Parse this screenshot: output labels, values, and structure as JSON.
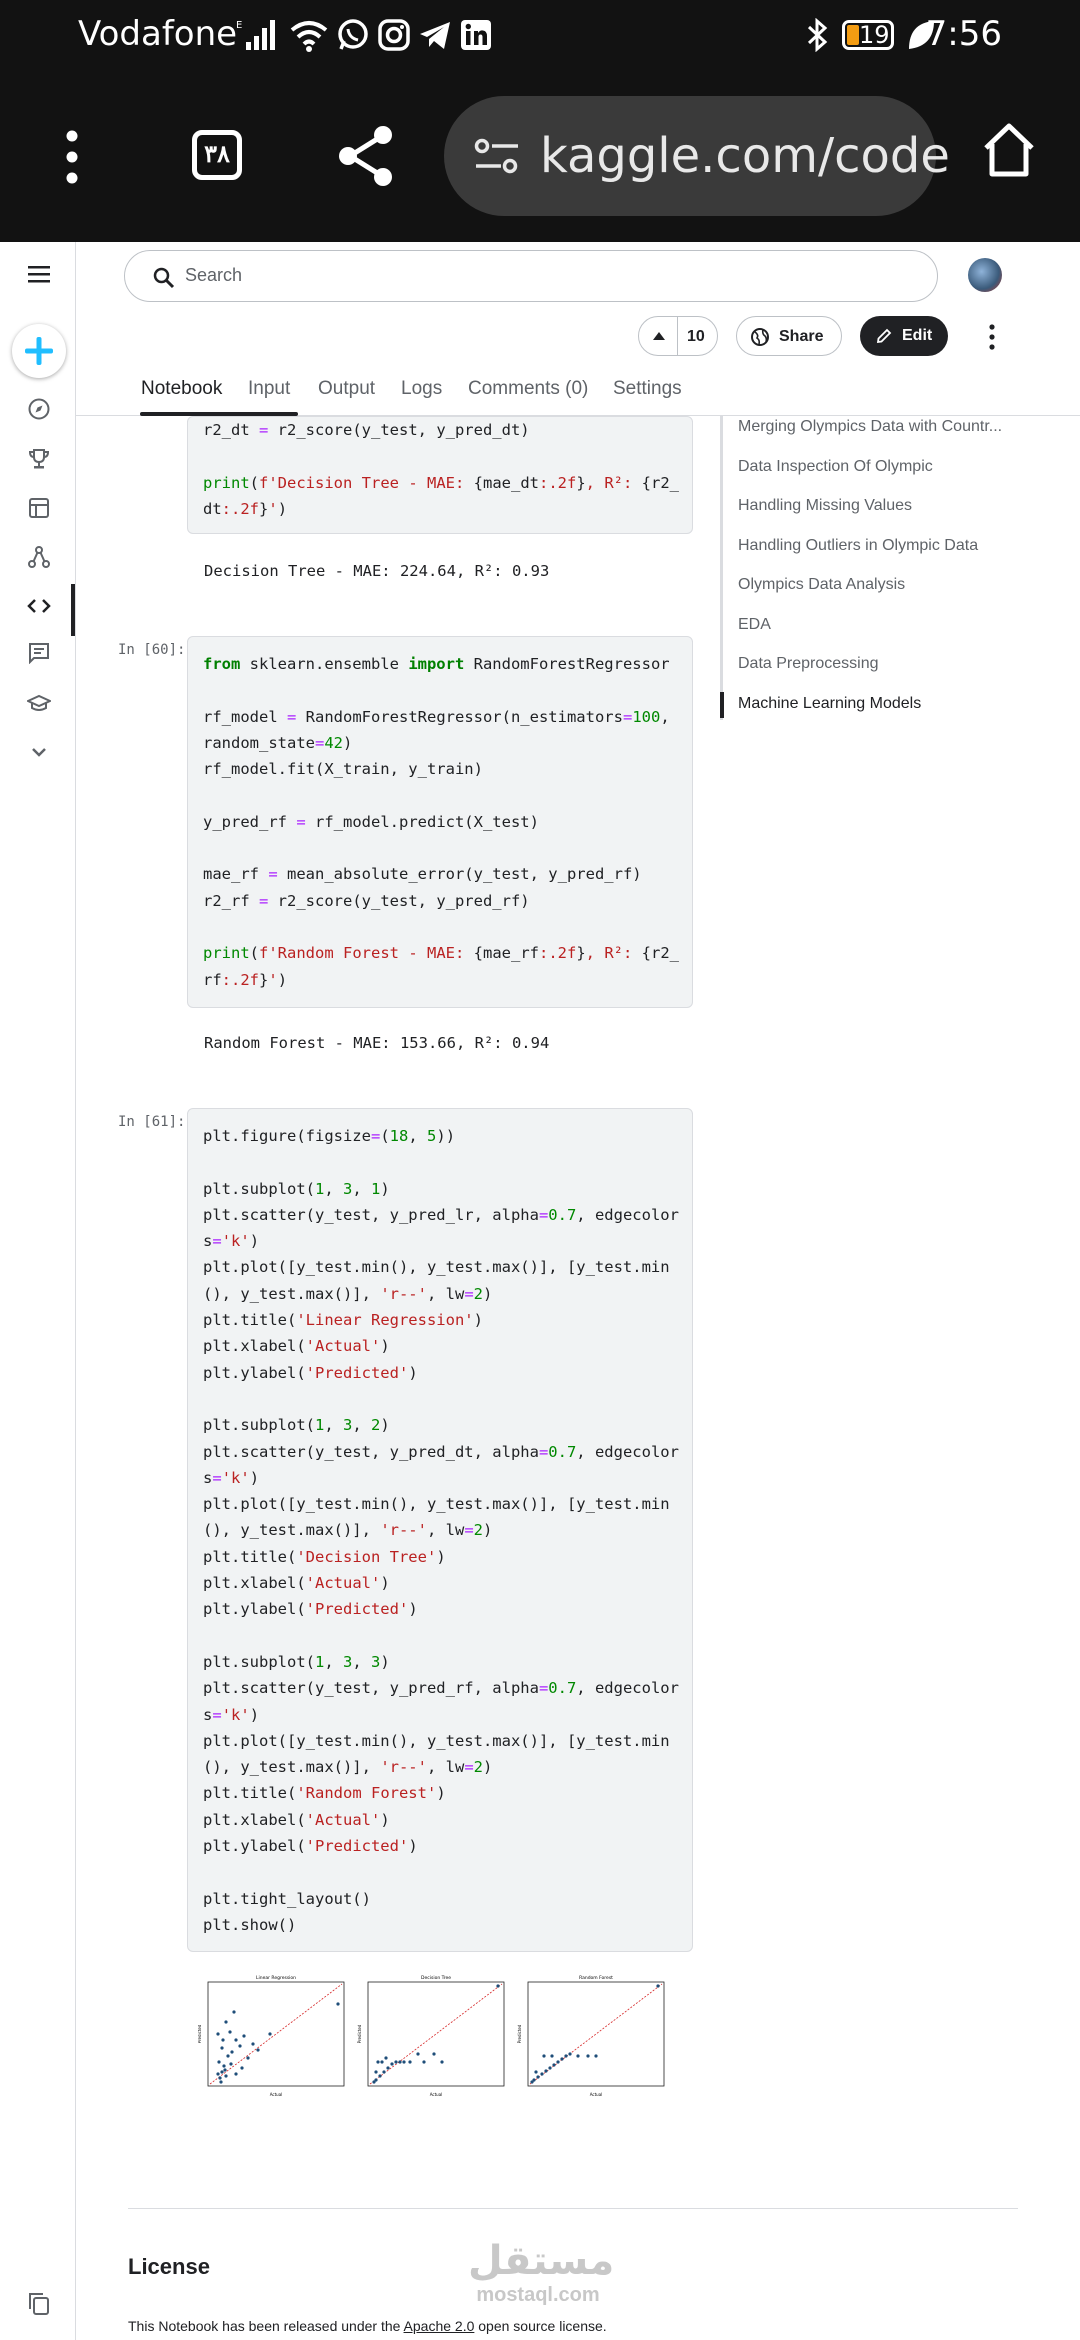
{
  "status_bar": {
    "carrier": "Vodafone",
    "battery": "19",
    "time": "7:56"
  },
  "browser": {
    "tab_count": "٣٨",
    "url": "kaggle.com/code"
  },
  "header": {
    "search_placeholder": "Search",
    "vote_count": "10",
    "share_label": "Share",
    "edit_label": "Edit"
  },
  "tabs": [
    "Notebook",
    "Input",
    "Output",
    "Logs",
    "Comments (0)",
    "Settings"
  ],
  "toc": {
    "items": [
      "Merging Olympics Data with Countr...",
      "Data Inspection Of Olympic",
      "Handling Missing Values",
      "Handling Outliers in Olympic Data",
      "Olympics Data Analysis",
      "EDA",
      "Data Preprocessing",
      "Machine Learning Models"
    ],
    "active": "Machine Learning Models"
  },
  "cells": {
    "cell59_output": "Decision Tree - MAE: 224.64, R²: 0.93",
    "cell60_prompt": "In [60]:",
    "cell60_output": "Random Forest - MAE: 153.66, R²: 0.94",
    "cell61_prompt": "In [61]:"
  },
  "plots": {
    "titles": [
      "Linear Regression",
      "Decision Tree",
      "Random Forest"
    ],
    "xlabel": "Actual",
    "ylabel": "Predicted"
  },
  "footer": {
    "license_title": "License",
    "license_pre": "This Notebook has been released under the ",
    "license_link": "Apache 2.0",
    "license_post": " open source license.",
    "watermark_ar": "مستقل",
    "watermark_en": "mostaql.com"
  }
}
